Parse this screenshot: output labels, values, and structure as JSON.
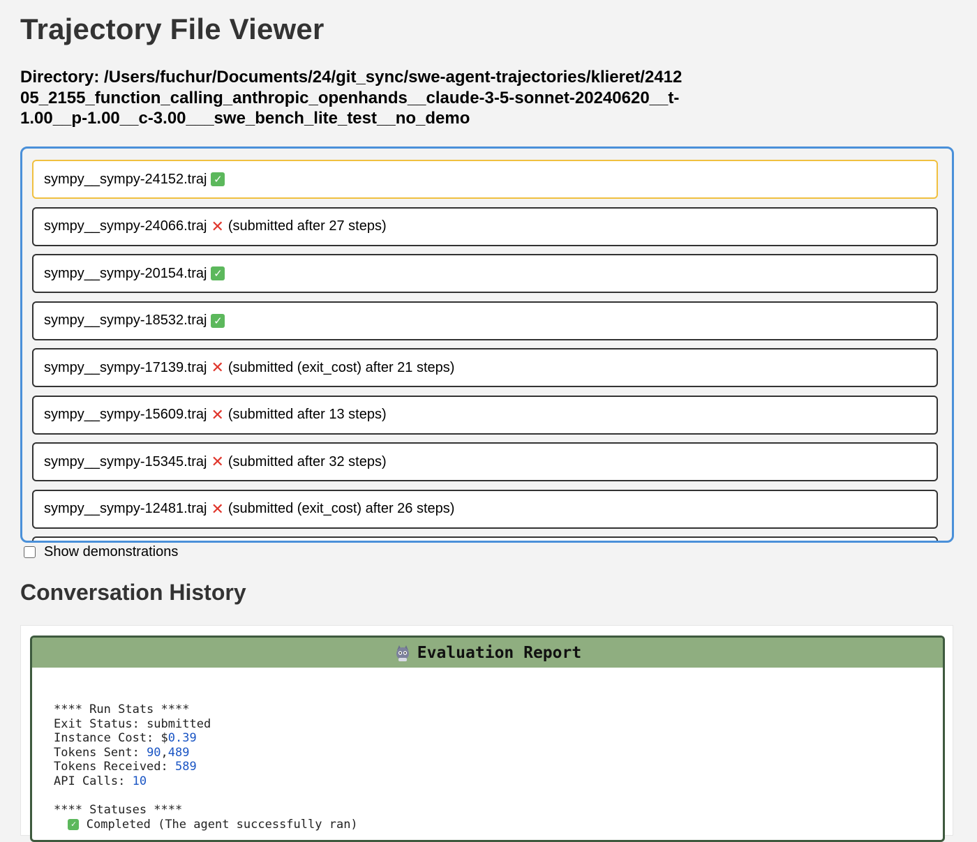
{
  "page": {
    "title": "Trajectory File Viewer",
    "directory_label": "Directory: /Users/fuchur/Documents/24/git_sync/swe-agent-trajectories/klieret/241205_2155_function_calling_anthropic_openhands__claude-3-5-sonnet-20240620__t-1.00__p-1.00__c-3.00___swe_bench_lite_test__no_demo"
  },
  "files": [
    {
      "name": "sympy__sympy-24152.traj",
      "status": "ok",
      "note": ""
    },
    {
      "name": "sympy__sympy-24066.traj",
      "status": "fail",
      "note": "(submitted after 27 steps)"
    },
    {
      "name": "sympy__sympy-20154.traj",
      "status": "ok",
      "note": ""
    },
    {
      "name": "sympy__sympy-18532.traj",
      "status": "ok",
      "note": ""
    },
    {
      "name": "sympy__sympy-17139.traj",
      "status": "fail",
      "note": "(submitted (exit_cost) after 21 steps)"
    },
    {
      "name": "sympy__sympy-15609.traj",
      "status": "fail",
      "note": "(submitted after 13 steps)"
    },
    {
      "name": "sympy__sympy-15345.traj",
      "status": "fail",
      "note": "(submitted after 32 steps)"
    },
    {
      "name": "sympy__sympy-12481.traj",
      "status": "fail",
      "note": "(submitted (exit_cost) after 26 steps)"
    }
  ],
  "demo_toggle": {
    "label": "Show demonstrations",
    "checked": false
  },
  "history": {
    "title": "Conversation History",
    "report_title": "Evaluation Report",
    "run_stats_heading": "**** Run Stats ****",
    "exit_status_label": "Exit Status: ",
    "exit_status_value": "submitted",
    "instance_cost_label": "Instance Cost: $",
    "instance_cost_value": "0.39",
    "tokens_sent_label": "Tokens Sent: ",
    "tokens_sent_a": "90",
    "tokens_sent_b": "489",
    "tokens_received_label": "Tokens Received: ",
    "tokens_received_value": "589",
    "api_calls_label": "API Calls: ",
    "api_calls_value": "10",
    "statuses_heading": "**** Statuses ****",
    "status_line": "Completed (The agent successfully ran)"
  },
  "colors": {
    "accent_border": "#4a90d9",
    "selected_border": "#f0c040",
    "ok_green": "#5cb85c",
    "fail_red": "#e0352b",
    "report_header": "#8fae80",
    "number_blue": "#1a55c4"
  },
  "icons": {
    "ok": "check-box-icon",
    "fail": "cross-icon",
    "mascot": "mascot-icon"
  }
}
